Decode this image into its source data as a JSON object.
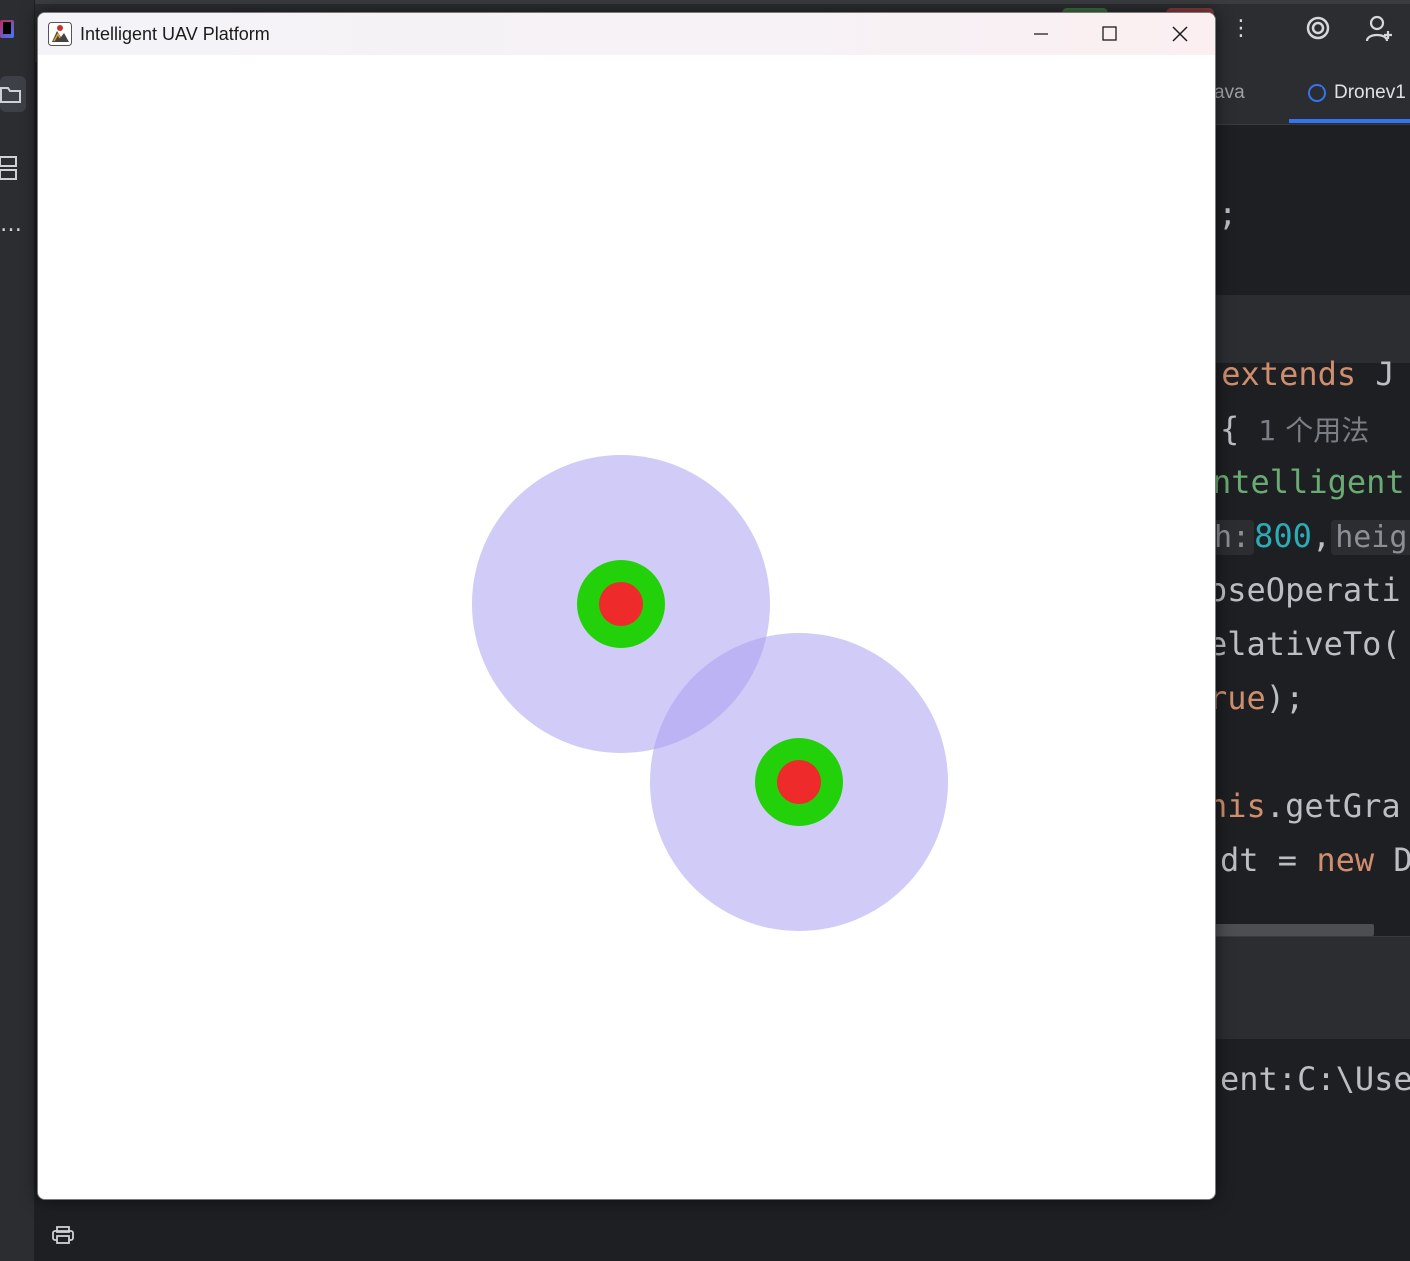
{
  "window": {
    "title": "Intelligent UAV Platform",
    "controls": [
      "minimize",
      "maximize",
      "close"
    ]
  },
  "canvas": {
    "background": "#ffffff",
    "drones": [
      {
        "id": "drone-1",
        "range_color": "rgba(170,160,240,0.55)",
        "ring_color": "#22d10a",
        "core_color": "#ee2a2a"
      },
      {
        "id": "drone-2",
        "range_color": "rgba(170,160,240,0.55)",
        "ring_color": "#22d10a",
        "core_color": "#ee2a2a"
      }
    ]
  },
  "ide": {
    "tabs": [
      {
        "label": "ava"
      },
      {
        "label": "Dronev1"
      }
    ],
    "code": {
      "line1": ";",
      "line2_kw": "extends",
      "line2_rest": "J",
      "line3_brace": "{",
      "line3_hint": "1 个用法",
      "line4": "ntelligent",
      "line5_hint1": "h:",
      "line5_num": "800",
      "line5_sep": ",",
      "line5_hint2": "heigh",
      "line6": "oseOperati",
      "line7": "elativeTo(",
      "line8_kw": "rue",
      "line8_rest": ");",
      "line9_kw": "his",
      "line9_rest": ".getGra",
      "line10_a": "dt = ",
      "line10_kw": "new",
      "line10_b": " D"
    },
    "console_text": "ent:C:\\Use"
  },
  "colors": {
    "accent": "#3574f0",
    "ide_bg": "#1e1f22"
  }
}
